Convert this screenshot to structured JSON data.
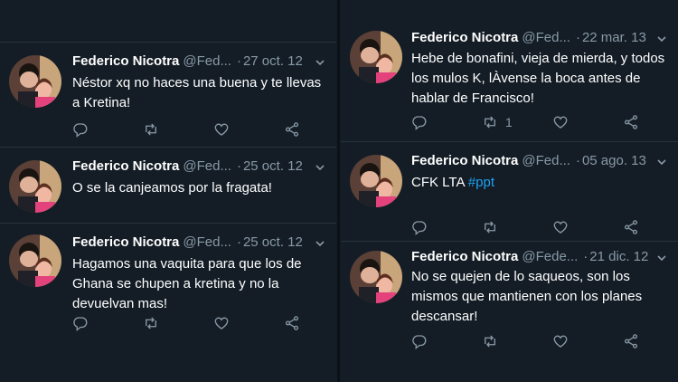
{
  "tweets_left": [
    {
      "name": "Federico Nicotra",
      "handle": "@Fed...",
      "dot": "·",
      "date": "27 oct. 12",
      "text": "Néstor xq no haces una buena y te llevas a Kretina!",
      "retweets": "",
      "hashtag": ""
    },
    {
      "name": "Federico Nicotra",
      "handle": "@Fed...",
      "dot": "·",
      "date": "25 oct. 12",
      "text": "O se la canjeamos por la fragata!",
      "retweets": "",
      "hashtag": ""
    },
    {
      "name": "Federico Nicotra",
      "handle": "@Fed...",
      "dot": "·",
      "date": "25 oct. 12",
      "text": "Hagamos una vaquita para que los de Ghana se chupen a kretina y no la devuelvan mas!",
      "retweets": "",
      "hashtag": ""
    }
  ],
  "tweets_right": [
    {
      "name": "Federico Nicotra",
      "handle": "@Fed...",
      "dot": "·",
      "date": "22 mar. 13",
      "text": "Hebe de bonafini, vieja de mierda, y todos los mulos K, lÀvense la boca antes de hablar de Francisco!",
      "retweets": "1",
      "hashtag": ""
    },
    {
      "name": "Federico Nicotra",
      "handle": "@Fed...",
      "dot": "·",
      "date": "05 ago. 13",
      "text": "CFK LTA ",
      "retweets": "",
      "hashtag": "#ppt"
    },
    {
      "name": "Federico Nicotra",
      "handle": "@Fede...",
      "dot": "·",
      "date": "21 dic. 12",
      "text": "No se quejen de lo saqueos, son los mismos que mantienen con los planes descansar!",
      "retweets": "",
      "hashtag": ""
    }
  ],
  "icons": {
    "reply": "reply-icon",
    "retweet": "retweet-icon",
    "like": "heart-icon",
    "share": "share-icon",
    "more": "chevron-down-icon"
  },
  "colors": {
    "background": "#141d26",
    "muted": "#8899a6",
    "link": "#1da1f2",
    "text": "#ffffff"
  }
}
